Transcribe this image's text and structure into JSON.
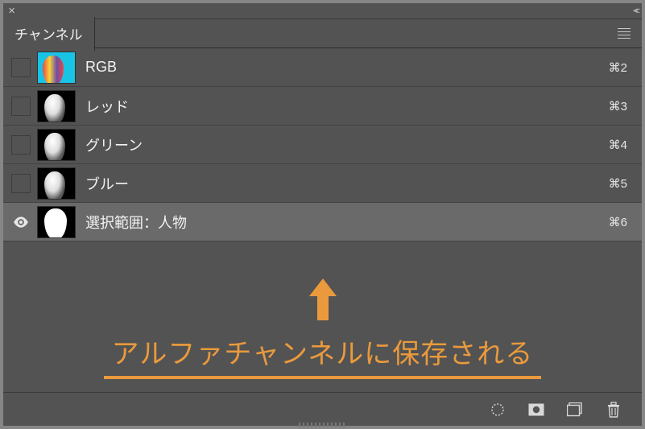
{
  "topbar": {
    "close": "✕",
    "collapse": "<<"
  },
  "panel": {
    "tab_label": "チャンネル"
  },
  "channels": [
    {
      "name": "RGB",
      "shortcut": "⌘2",
      "visible": false,
      "thumb": "rgb",
      "selected": false
    },
    {
      "name": "レッド",
      "shortcut": "⌘3",
      "visible": false,
      "thumb": "bw",
      "selected": false
    },
    {
      "name": "グリーン",
      "shortcut": "⌘4",
      "visible": false,
      "thumb": "bw",
      "selected": false
    },
    {
      "name": "ブルー",
      "shortcut": "⌘5",
      "visible": false,
      "thumb": "bw",
      "selected": false
    },
    {
      "name": "選択範囲：人物",
      "shortcut": "⌘6",
      "visible": true,
      "thumb": "alpha",
      "selected": true
    }
  ],
  "annotation": {
    "text": "アルファチャンネルに保存される"
  },
  "icons": {
    "load_selection": "load-selection-icon",
    "save_selection": "save-selection-icon",
    "new_channel": "new-channel-icon",
    "delete_channel": "delete-channel-icon"
  }
}
